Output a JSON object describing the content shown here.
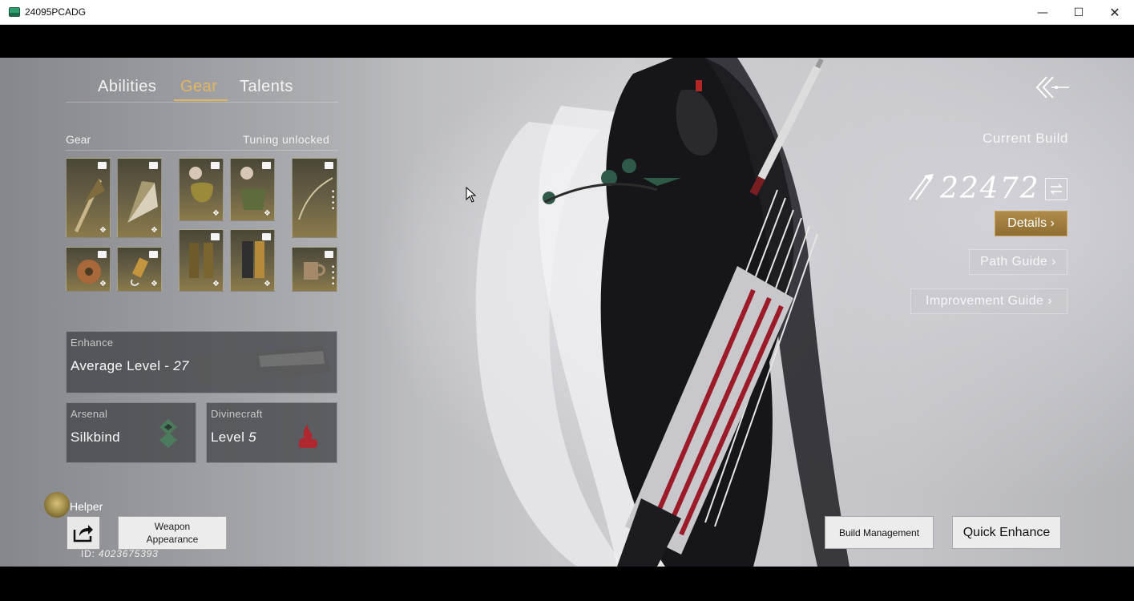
{
  "window": {
    "title": "24095PCADG",
    "minimize": "—",
    "maximize": "☐",
    "close": "✕"
  },
  "tabs": [
    {
      "label": "Abilities",
      "active": false
    },
    {
      "label": "Gear",
      "active": true
    },
    {
      "label": "Talents",
      "active": false
    }
  ],
  "gear_panel": {
    "title": "Gear",
    "status": "Tuning unlocked",
    "slots": [
      {
        "icon": "parasol-weapon-icon",
        "group": "weapons"
      },
      {
        "icon": "fan-weapon-icon",
        "group": "weapons"
      },
      {
        "icon": "disc-accessory-icon",
        "group": "weapons"
      },
      {
        "icon": "pendant-accessory-icon",
        "group": "weapons"
      },
      {
        "icon": "helmet-armor-icon",
        "group": "armor"
      },
      {
        "icon": "chest-armor-icon",
        "group": "armor"
      },
      {
        "icon": "gloves-armor-icon",
        "group": "armor"
      },
      {
        "icon": "greaves-armor-icon",
        "group": "armor"
      },
      {
        "icon": "bow-ranged-icon",
        "group": "ranged"
      },
      {
        "icon": "cup-ranged-icon",
        "group": "ranged"
      }
    ]
  },
  "enhance": {
    "caption": "Enhance",
    "value_prefix": "Average Level - ",
    "value": "27"
  },
  "arsenal": {
    "caption": "Arsenal",
    "value": "Silkbind",
    "accent": "#4c7a5c"
  },
  "divinecraft": {
    "caption": "Divinecraft",
    "value_prefix": "Level ",
    "value": "5",
    "accent": "#b0282f"
  },
  "helper": {
    "label": "Helper"
  },
  "weapon_appearance": {
    "line1": "Weapon",
    "line2": "Appearance"
  },
  "player_id": {
    "prefix": "ID: ",
    "value": "4023675393"
  },
  "build": {
    "title": "Current Build",
    "score": "22472",
    "details": "Details ›",
    "path_guide": "Path Guide ›",
    "improvement_guide": "Improvement Guide ›",
    "accent": "#a07d3e"
  },
  "actions": {
    "build_management": "Build Management",
    "quick_enhance": "Quick Enhance"
  }
}
